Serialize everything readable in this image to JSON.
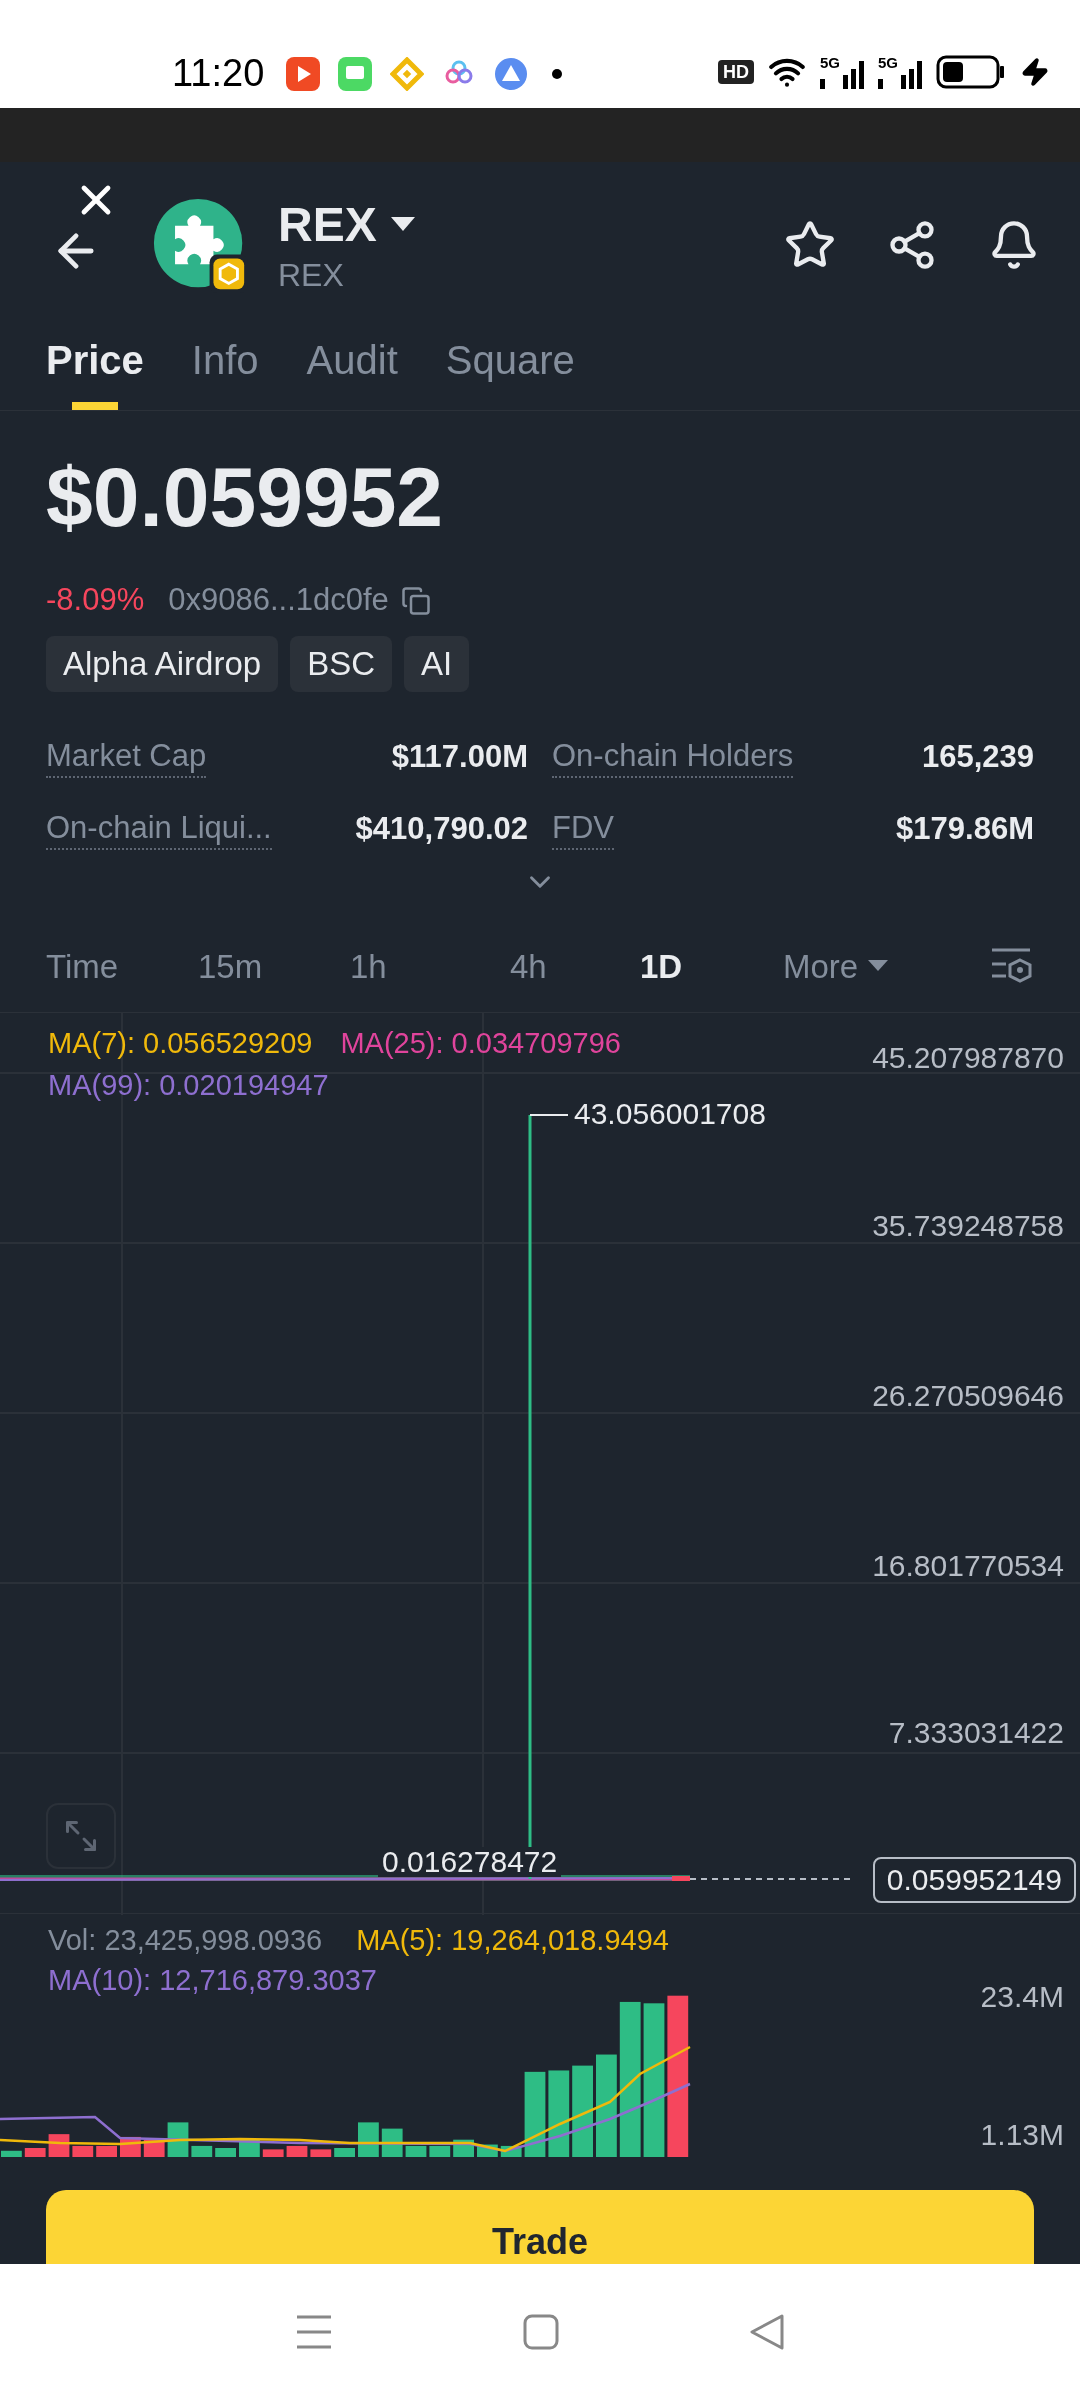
{
  "status_bar": {
    "time": "11:20",
    "hd_label": "HD",
    "network_labels": [
      "5G",
      "5G"
    ]
  },
  "header": {
    "title": "REX",
    "subtitle": "REX"
  },
  "tabs": [
    {
      "label": "Price",
      "selected": true
    },
    {
      "label": "Info",
      "selected": false
    },
    {
      "label": "Audit",
      "selected": false
    },
    {
      "label": "Square",
      "selected": false
    }
  ],
  "price": {
    "value": "$0.059952",
    "change": "-8.09%",
    "address": "0x9086...1dc0fe",
    "tags": [
      "Alpha Airdrop",
      "BSC",
      "AI"
    ]
  },
  "stats": [
    {
      "label": "Market Cap",
      "value": "$117.00M"
    },
    {
      "label": "On-chain Holders",
      "value": "165,239"
    },
    {
      "label": "On-chain Liqui...",
      "value": "$410,790.02"
    },
    {
      "label": "FDV",
      "value": "$179.86M"
    }
  ],
  "intervals_label": "Time",
  "intervals": [
    {
      "label": "15m",
      "selected": false
    },
    {
      "label": "1h",
      "selected": false
    },
    {
      "label": "4h",
      "selected": false
    },
    {
      "label": "1D",
      "selected": true
    }
  ],
  "more_label": "More",
  "price_chart": {
    "indicators": [
      {
        "label": "MA(7): 0.056529209",
        "color": "#f0b90b"
      },
      {
        "label": "MA(25): 0.034709796",
        "color": "#e0449c"
      },
      {
        "label": "MA(99): 0.020194947",
        "color": "#8e6fd0"
      }
    ],
    "axis_labels": [
      "45.207987870",
      "35.739248758",
      "26.270509646",
      "16.801770534",
      "7.333031422"
    ],
    "high_label": "43.056001708",
    "low_label": "0.016278472",
    "last_price": "0.059952149"
  },
  "volume": {
    "indicators": [
      {
        "label": "Vol: 23,425,998.0936",
        "color": "#848e9c"
      },
      {
        "label": "MA(5): 19,264,018.9494",
        "color": "#f0b90b"
      },
      {
        "label": "MA(10): 12,716,879.3037",
        "color": "#8e6fd0"
      }
    ],
    "axis_labels": [
      "23.4M",
      "1.13M"
    ]
  },
  "trade_button": {
    "label": "Trade"
  }
}
